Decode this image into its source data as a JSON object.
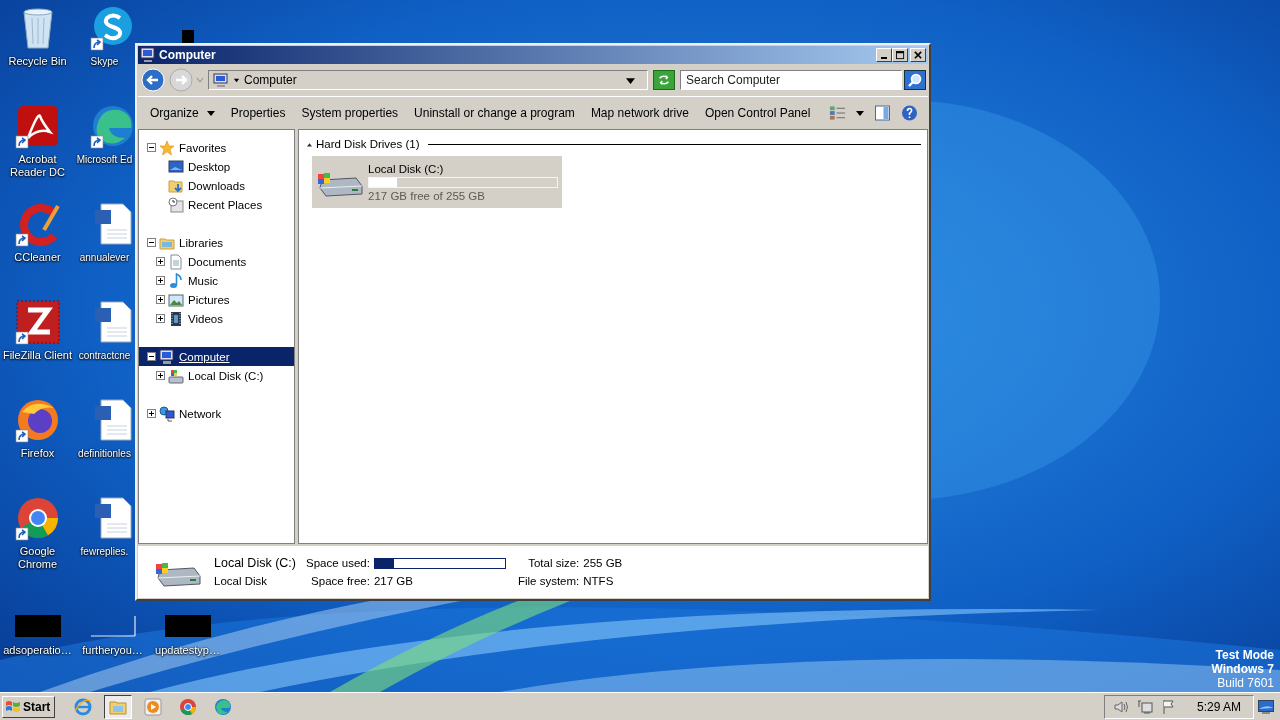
{
  "desktop_icons": [
    {
      "label": "Recycle Bin",
      "kind": "recycle",
      "shortcut": false
    },
    {
      "label": "Acrobat Reader DC",
      "kind": "acrobat",
      "shortcut": true
    },
    {
      "label": "CCleaner",
      "kind": "ccleaner",
      "shortcut": true
    },
    {
      "label": "FileZilla Client",
      "kind": "filezilla",
      "shortcut": true
    },
    {
      "label": "Firefox",
      "kind": "firefox",
      "shortcut": true
    },
    {
      "label": "Google Chrome",
      "kind": "chrome",
      "shortcut": true
    },
    {
      "label": "Skype",
      "kind": "skype",
      "shortcut": true
    },
    {
      "label": "Microsoft Ed",
      "kind": "edge",
      "shortcut": true
    },
    {
      "label": "annualever",
      "kind": "word",
      "shortcut": false
    },
    {
      "label": "contractcne",
      "kind": "word",
      "shortcut": false
    },
    {
      "label": "definitionles",
      "kind": "word",
      "shortcut": false
    },
    {
      "label": "fewreplies.",
      "kind": "word",
      "shortcut": false
    },
    {
      "kind": "redacted",
      "shortcut": false
    }
  ],
  "desktop_bottom_icons": [
    {
      "label": "adsoperatio…",
      "kind": "redacted"
    },
    {
      "label": "furtheryou…",
      "kind": "blank"
    },
    {
      "label": "updatestyp…",
      "kind": "redacted"
    }
  ],
  "window": {
    "title": "Computer",
    "back_enabled": true,
    "forward_enabled": false,
    "address": {
      "path": "Computer"
    },
    "search": {
      "placeholder": "Search Computer"
    },
    "commands": [
      {
        "label": "Organize",
        "dropdown": true
      },
      {
        "label": "Properties",
        "dropdown": false
      },
      {
        "label": "System properties",
        "dropdown": false
      },
      {
        "label": "Uninstall or change a program",
        "dropdown": false
      },
      {
        "label": "Map network drive",
        "dropdown": false
      },
      {
        "label": "Open Control Panel",
        "dropdown": false
      }
    ],
    "nav_tree": [
      {
        "label": "Favorites",
        "kind": "star",
        "expanded": true,
        "selected": false,
        "children": [
          {
            "label": "Desktop",
            "kind": "desktop",
            "selected": false
          },
          {
            "label": "Downloads",
            "kind": "downloads",
            "selected": false
          },
          {
            "label": "Recent Places",
            "kind": "recent",
            "selected": false
          }
        ]
      },
      {
        "label": "Libraries",
        "kind": "libraries",
        "expanded": true,
        "selected": false,
        "children": [
          {
            "label": "Documents",
            "kind": "documents",
            "expanded": false,
            "selected": false
          },
          {
            "label": "Music",
            "kind": "music",
            "expanded": false,
            "selected": false
          },
          {
            "label": "Pictures",
            "kind": "pictures",
            "expanded": false,
            "selected": false
          },
          {
            "label": "Videos",
            "kind": "videos",
            "expanded": false,
            "selected": false
          }
        ]
      },
      {
        "label": "Computer",
        "kind": "computer",
        "expanded": true,
        "selected": true,
        "children": [
          {
            "label": "Local Disk (C:)",
            "kind": "drive",
            "expanded": false,
            "selected": false
          }
        ]
      },
      {
        "label": "Network",
        "kind": "network",
        "expanded": false,
        "selected": false
      }
    ],
    "groups": [
      {
        "title": "Hard Disk Drives (1)",
        "expanded": true,
        "items": [
          {
            "name": "Local Disk (C:)",
            "level": 0.15,
            "free_text": "217 GB free of 255 GB",
            "selected": true
          }
        ]
      }
    ],
    "details": {
      "name": "Local Disk (C:)",
      "type": "Local Disk",
      "used_label": "Space used:",
      "level": 0.15,
      "fields": [
        {
          "label": "Total size:",
          "value": "255 GB"
        },
        {
          "label": "Space free:",
          "value": "217 GB"
        },
        {
          "label": "File system:",
          "value": "NTFS"
        }
      ]
    }
  },
  "os_notice": [
    "Test Mode",
    "Windows 7",
    "Build 7601"
  ],
  "taskbar": {
    "start": "Start",
    "apps": [
      {
        "kind": "ie",
        "active": false
      },
      {
        "kind": "explorer",
        "active": true
      },
      {
        "kind": "media",
        "active": false
      },
      {
        "kind": "chrome",
        "active": false
      },
      {
        "kind": "edge",
        "active": false
      }
    ],
    "clock": "5:29 AM"
  }
}
